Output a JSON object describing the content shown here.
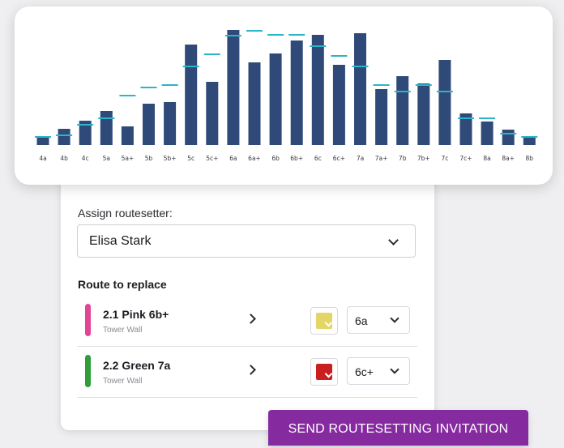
{
  "form": {
    "assign_label": "Assign routesetter:",
    "setter_value": "Elisa Stark",
    "route_heading": "Route to replace",
    "routes": [
      {
        "name": "2.1 Pink 6b+",
        "wall": "Tower Wall",
        "stripe_color": "#e24596",
        "swatch_color": "#e3d566",
        "grade": "6a"
      },
      {
        "name": "2.2 Green 7a",
        "wall": "Tower Wall",
        "stripe_color": "#2f9e3a",
        "swatch_color": "#c9201f",
        "grade": "6c+"
      }
    ]
  },
  "send_button_label": "SEND ROUTESETTING INVITATION",
  "colors": {
    "bar": "#2f4a78",
    "target_line": "#2bb5c8",
    "button": "#862aa0"
  },
  "chart_data": {
    "type": "bar",
    "categories": [
      "4a",
      "4b",
      "4c",
      "5a",
      "5a+",
      "5b",
      "5b+",
      "5c",
      "5c+",
      "6a",
      "6a+",
      "6b",
      "6b+",
      "6c",
      "6c+",
      "7a",
      "7a+",
      "7b",
      "7b+",
      "7c",
      "7c+",
      "8a",
      "8a+",
      "8b"
    ],
    "series": [
      {
        "values": [
          1,
          2,
          3,
          4.2,
          2.3,
          5.1,
          5.3,
          12.4,
          7.8,
          14.2,
          10.2,
          11.3,
          12.9,
          13.6,
          9.9,
          13.8,
          6.9,
          8.5,
          7.6,
          10.5,
          3.9,
          2.9,
          1.9,
          1.1
        ]
      },
      {
        "values": [
          1,
          1.2,
          2.5,
          3.3,
          6.1,
          7.1,
          7.4,
          9.7,
          11.2,
          13.5,
          14.1,
          13.6,
          13.6,
          12.2,
          11,
          9.7,
          7.4,
          6.6,
          7.4,
          6.6,
          3.3,
          3.3,
          1.4,
          1
        ]
      }
    ],
    "ylim": [
      0,
      15
    ],
    "xlabel": "",
    "ylabel": "",
    "title": ""
  }
}
